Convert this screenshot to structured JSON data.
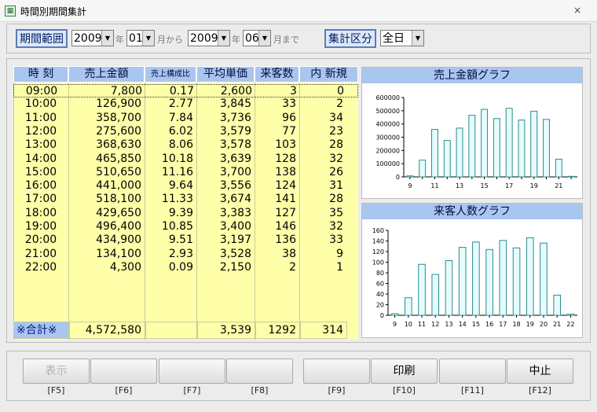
{
  "window": {
    "title": "時間別期間集計",
    "close": "×"
  },
  "period": {
    "label": "期間範囲",
    "start_year": "2009",
    "start_year_unit": "年",
    "start_month": "01",
    "start_month_unit": "月から",
    "end_year": "2009",
    "end_year_unit": "年",
    "end_month": "06",
    "end_month_unit": "月まで"
  },
  "category": {
    "label": "集計区分",
    "value": "全日"
  },
  "table": {
    "headers": [
      "時 刻",
      "売上金額",
      "売上構成比",
      "平均単価",
      "来客数",
      "内 新規"
    ],
    "rows": [
      {
        "time": "09:00",
        "sales": "7,800",
        "ratio": "0.17",
        "avg": "2,600",
        "visitors": "3",
        "new": "0"
      },
      {
        "time": "10:00",
        "sales": "126,900",
        "ratio": "2.77",
        "avg": "3,845",
        "visitors": "33",
        "new": "2"
      },
      {
        "time": "11:00",
        "sales": "358,700",
        "ratio": "7.84",
        "avg": "3,736",
        "visitors": "96",
        "new": "34"
      },
      {
        "time": "12:00",
        "sales": "275,600",
        "ratio": "6.02",
        "avg": "3,579",
        "visitors": "77",
        "new": "23"
      },
      {
        "time": "13:00",
        "sales": "368,630",
        "ratio": "8.06",
        "avg": "3,578",
        "visitors": "103",
        "new": "28"
      },
      {
        "time": "14:00",
        "sales": "465,850",
        "ratio": "10.18",
        "avg": "3,639",
        "visitors": "128",
        "new": "32"
      },
      {
        "time": "15:00",
        "sales": "510,650",
        "ratio": "11.16",
        "avg": "3,700",
        "visitors": "138",
        "new": "26"
      },
      {
        "time": "16:00",
        "sales": "441,000",
        "ratio": "9.64",
        "avg": "3,556",
        "visitors": "124",
        "new": "31"
      },
      {
        "time": "17:00",
        "sales": "518,100",
        "ratio": "11.33",
        "avg": "3,674",
        "visitors": "141",
        "new": "28"
      },
      {
        "time": "18:00",
        "sales": "429,650",
        "ratio": "9.39",
        "avg": "3,383",
        "visitors": "127",
        "new": "35"
      },
      {
        "time": "19:00",
        "sales": "496,400",
        "ratio": "10.85",
        "avg": "3,400",
        "visitors": "146",
        "new": "32"
      },
      {
        "time": "20:00",
        "sales": "434,900",
        "ratio": "9.51",
        "avg": "3,197",
        "visitors": "136",
        "new": "33"
      },
      {
        "time": "21:00",
        "sales": "134,100",
        "ratio": "2.93",
        "avg": "3,528",
        "visitors": "38",
        "new": "9"
      },
      {
        "time": "22:00",
        "sales": "4,300",
        "ratio": "0.09",
        "avg": "2,150",
        "visitors": "2",
        "new": "1"
      }
    ],
    "totals": {
      "label": "※合計※",
      "sales": "4,572,580",
      "ratio": "",
      "avg": "3,539",
      "visitors": "1292",
      "new": "314"
    }
  },
  "chart_data": [
    {
      "type": "bar",
      "title": "売上金額グラフ",
      "x": [
        9,
        10,
        11,
        12,
        13,
        14,
        15,
        16,
        17,
        18,
        19,
        20,
        21,
        22
      ],
      "x_tick_labels": [
        "9",
        "",
        "11",
        "",
        "13",
        "",
        "15",
        "",
        "17",
        "",
        "19",
        "",
        "21",
        ""
      ],
      "values": [
        7800,
        126900,
        358700,
        275600,
        368630,
        465850,
        510650,
        441000,
        518100,
        429650,
        496400,
        434900,
        134100,
        4300
      ],
      "ylim": [
        0,
        600000
      ],
      "yticks": [
        0,
        100000,
        200000,
        300000,
        400000,
        500000,
        600000
      ],
      "bar_color": "#e6fbfd",
      "bar_edge": "#2a8c8c",
      "grid": false
    },
    {
      "type": "bar",
      "title": "来客人数グラフ",
      "x": [
        9,
        10,
        11,
        12,
        13,
        14,
        15,
        16,
        17,
        18,
        19,
        20,
        21,
        22
      ],
      "x_tick_labels": [
        "9",
        "10",
        "11",
        "12",
        "13",
        "14",
        "15",
        "16",
        "17",
        "18",
        "19",
        "20",
        "21",
        "22"
      ],
      "values": [
        3,
        33,
        96,
        77,
        103,
        128,
        138,
        124,
        141,
        127,
        146,
        136,
        38,
        2
      ],
      "ylim": [
        0,
        160
      ],
      "yticks": [
        0,
        20,
        40,
        60,
        80,
        100,
        120,
        140,
        160
      ],
      "bar_color": "#e6fbfd",
      "bar_edge": "#2a8c8c",
      "grid": false
    }
  ],
  "function_keys": [
    {
      "label": "表示",
      "key": "[F5]",
      "enabled": false
    },
    {
      "label": "",
      "key": "[F6]",
      "enabled": false
    },
    {
      "label": "",
      "key": "[F7]",
      "enabled": false
    },
    {
      "label": "",
      "key": "[F8]",
      "enabled": false
    },
    {
      "label": "",
      "key": "[F9]",
      "enabled": false
    },
    {
      "label": "印刷",
      "key": "[F10]",
      "enabled": true
    },
    {
      "label": "",
      "key": "[F11]",
      "enabled": false
    },
    {
      "label": "中止",
      "key": "[F12]",
      "enabled": true
    }
  ]
}
